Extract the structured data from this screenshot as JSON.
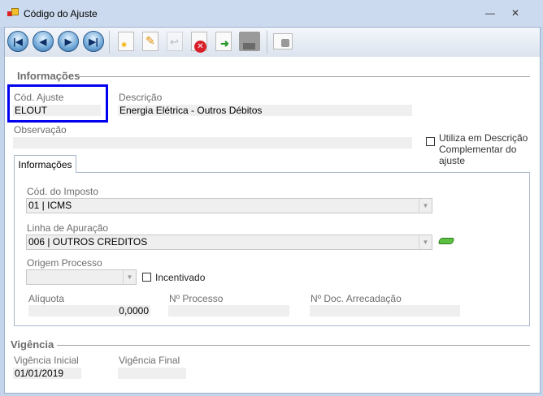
{
  "window": {
    "title": "Código do Ajuste",
    "minimize": "—",
    "close": "✕"
  },
  "toolbar": {
    "icons": [
      "first-record",
      "previous-record",
      "next-record",
      "last-record",
      "new",
      "edit",
      "undo",
      "delete",
      "export",
      "save",
      "lock"
    ]
  },
  "section_info": "Informações",
  "cod_ajuste": {
    "label": "Cód. Ajuste",
    "value": "ELOUT"
  },
  "descricao": {
    "label": "Descrição",
    "value": "Energia Elétrica - Outros Débitos"
  },
  "observacao": {
    "label": "Observação",
    "value": ""
  },
  "utiliza": {
    "line1": "Utiliza em Descrição",
    "line2": "Complementar do ajuste",
    "checked": false
  },
  "tab": {
    "label": "Informações"
  },
  "cod_imposto": {
    "label": "Cód. do Imposto",
    "value": "01 | ICMS"
  },
  "linha_apuracao": {
    "label": "Linha de Apuração",
    "value": "006 | OUTROS CREDITOS"
  },
  "origem_processo": {
    "label": "Origem Processo",
    "value": ""
  },
  "incentivado": {
    "label": "Incentivado",
    "checked": false
  },
  "aliquota": {
    "label": "Alíquota",
    "value": "0,0000"
  },
  "num_processo": {
    "label": "Nº Processo",
    "value": ""
  },
  "num_doc": {
    "label": "Nº Doc. Arrecadação",
    "value": ""
  },
  "section_vigencia": "Vigência",
  "vig_inicial": {
    "label": "Vigência Inicial",
    "value": "01/01/2019"
  },
  "vig_final": {
    "label": "Vigência Final",
    "value": ""
  },
  "colors": {
    "highlight": "#0000ee"
  }
}
